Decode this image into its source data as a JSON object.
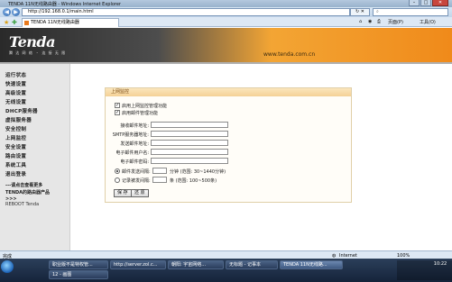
{
  "browser": {
    "window_title": "TENDA 11N无线路由器 - Windows Internet Explorer",
    "address": "http://192.168.0.1/main.html",
    "tab_title": "TENDA 11N无线路由器",
    "cmd_page": "页面(P)",
    "cmd_tools": "工具(O)",
    "window_buttons": {
      "minimize": "–",
      "maximize": "□",
      "close": "✕"
    }
  },
  "banner": {
    "logo": "Tenda",
    "logo_tagline": "腾 达 网 络 ・ 连 接 无 限",
    "site": "www.tenda.com.cn"
  },
  "sidebar": {
    "items": [
      {
        "label": "运行状态"
      },
      {
        "label": "快速设置"
      },
      {
        "label": "高级设置"
      },
      {
        "label": "无线设置"
      },
      {
        "label": "DHCP服务器"
      },
      {
        "label": "虚拟服务器"
      },
      {
        "label": "安全控制"
      },
      {
        "label": "上网监控"
      },
      {
        "label": "安全设置"
      },
      {
        "label": "路由设置"
      },
      {
        "label": "系统工具"
      },
      {
        "label": "退出登录"
      }
    ],
    "hint_line1": "---请点击查看更多",
    "hint_line2": "TENDA的路由器产品",
    "hint_line3": ">>>",
    "reboot": "REBOOT Tenda"
  },
  "form": {
    "title": "上网监控",
    "enable_monitor": "启用上网监控管理功能",
    "enable_mail": "启用邮件管理功能",
    "fields": [
      {
        "label": "接收邮件地址:",
        "value": ""
      },
      {
        "label": "SMTP服务器地址:",
        "value": ""
      },
      {
        "label": "发送邮件地址:",
        "value": ""
      },
      {
        "label": "电子邮件用户名:",
        "value": ""
      },
      {
        "label": "电子邮件密码:",
        "value": ""
      }
    ],
    "interval_label": "邮件发送间隔:",
    "interval_unit": "分钟 (范围: 30~1440分钟)",
    "count_label": "记录被发间隔:",
    "count_unit": "条 (范围: 100~500条)",
    "save": "保 存",
    "cancel": "还 原"
  },
  "statusbar": {
    "left": "完成",
    "zone": "Internet",
    "zoom": "100%"
  },
  "taskbar": {
    "tasks": [
      {
        "label": "职业版不是特权管..."
      },
      {
        "label": "http://server.zol.c..."
      },
      {
        "label": "朝阳: 宇宙网络..."
      },
      {
        "label": "无标题 - 记事本"
      },
      {
        "label": "TENDA 11N无线路..."
      }
    ],
    "sub_task": "12 - 画图",
    "clock": "10:22"
  }
}
